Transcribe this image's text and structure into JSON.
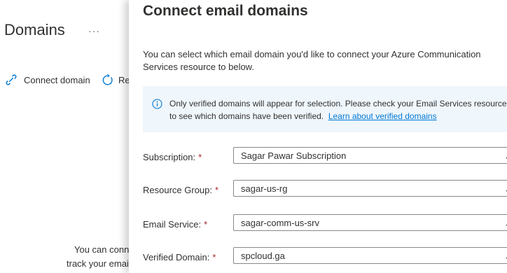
{
  "background": {
    "title": "Domains",
    "more_glyph": "···",
    "commands": {
      "connect_label": "Connect domain",
      "refresh_label": "Re"
    },
    "empty_state": {
      "line1": "You can conn",
      "line2": "track your emai"
    },
    "icons": [
      "link-icon",
      "refresh-icon"
    ]
  },
  "panel": {
    "title": "Connect email domains",
    "description": "You can select which email domain you'd like to connect your Azure Communication Services resource to below.",
    "info": {
      "text_line1": "Only verified domains will appear for selection. Please check your Email Services resource",
      "text_line2": "to see which domains have been verified.",
      "link": "Learn about verified domains",
      "icon": "info-icon"
    },
    "required_mark": "*",
    "fields": [
      {
        "label": "Subscription:",
        "value": "Sagar Pawar Subscription"
      },
      {
        "label": "Resource Group:",
        "value": "sagar-us-rg"
      },
      {
        "label": "Email Service:",
        "value": "sagar-comm-us-srv"
      },
      {
        "label": "Verified Domain:",
        "value": "spcloud.ga"
      }
    ]
  },
  "colors": {
    "accent": "#0078d4",
    "required": "#a4262c",
    "info_background": "#eff6fc"
  }
}
